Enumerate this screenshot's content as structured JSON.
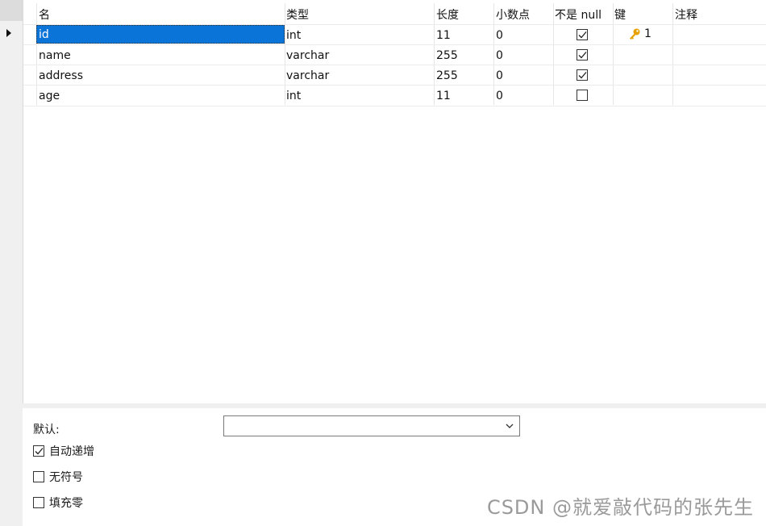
{
  "grid": {
    "columns": [
      "名",
      "类型",
      "长度",
      "小数点",
      "不是 null",
      "键",
      "注释"
    ],
    "rows": [
      {
        "name": "id",
        "type": "int",
        "length": "11",
        "decimals": "0",
        "not_null": true,
        "key": "1",
        "comment": ""
      },
      {
        "name": "name",
        "type": "varchar",
        "length": "255",
        "decimals": "0",
        "not_null": true,
        "key": "",
        "comment": ""
      },
      {
        "name": "address",
        "type": "varchar",
        "length": "255",
        "decimals": "0",
        "not_null": true,
        "key": "",
        "comment": ""
      },
      {
        "name": "age",
        "type": "int",
        "length": "11",
        "decimals": "0",
        "not_null": false,
        "key": "",
        "comment": ""
      }
    ],
    "selected_row": 0
  },
  "properties": {
    "default_label": "默认:",
    "default_value": "",
    "auto_increment_label": "自动递增",
    "auto_increment_checked": true,
    "unsigned_label": "无符号",
    "unsigned_checked": false,
    "zerofill_label": "填充零",
    "zerofill_checked": false
  },
  "watermark": "CSDN @就爱敲代码的张先生",
  "colors": {
    "selection": "#0a74d9",
    "key_icon": "#e6a100"
  },
  "icons": {
    "row_indicator": "triangle-right-icon",
    "key": "key-icon",
    "checkbox_check": "checkmark-icon",
    "select_chevron": "chevron-down-icon"
  }
}
